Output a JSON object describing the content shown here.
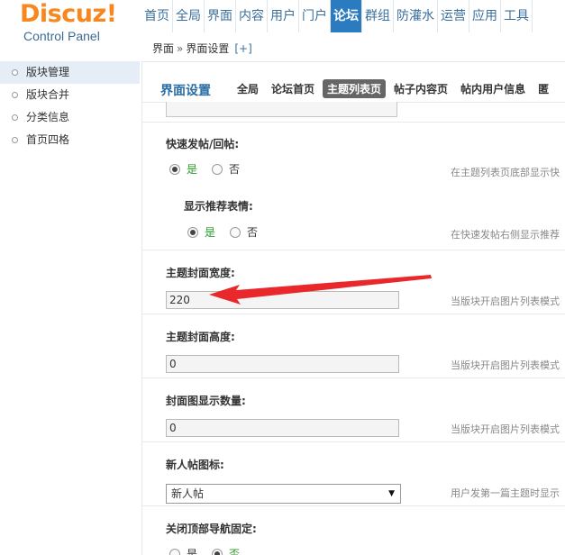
{
  "header": {
    "logo_main": "Discuz",
    "logo_bang": "!",
    "logo_sub": "Control Panel",
    "nav": [
      "首页",
      "全局",
      "界面",
      "内容",
      "用户",
      "门户",
      "论坛",
      "群组",
      "防灌水",
      "运营",
      "应用",
      "工具"
    ],
    "active_nav": "论坛"
  },
  "sidebar": {
    "items": [
      {
        "label": "版块管理"
      },
      {
        "label": "版块合并"
      },
      {
        "label": "分类信息"
      },
      {
        "label": "首页四格"
      }
    ]
  },
  "breadcrumb": {
    "part1": "界面",
    "sep": "»",
    "part2": "界面设置",
    "plus": "[+]"
  },
  "page": {
    "title": "界面设置",
    "tabs": [
      "全局",
      "论坛首页",
      "主题列表页",
      "帖子内容页",
      "帖内用户信息",
      "匿"
    ],
    "active_tab": "主题列表页"
  },
  "form": {
    "fast_post": {
      "label": "快速发帖/回帖:",
      "yes": "是",
      "no": "否",
      "desc": "在主题列表页底部显示快"
    },
    "recommend_emoji": {
      "label": "显示推荐表情:",
      "yes": "是",
      "no": "否",
      "desc": "在快速发帖右侧显示推荐"
    },
    "cover_width": {
      "label": "主题封面宽度:",
      "value": "220",
      "desc": "当版块开启图片列表模式"
    },
    "cover_height": {
      "label": "主题封面高度:",
      "value": "0",
      "desc": "当版块开启图片列表模式"
    },
    "cover_count": {
      "label": "封面图显示数量:",
      "value": "0",
      "desc": "当版块开启图片列表模式"
    },
    "new_post_icon": {
      "label": "新人帖图标:",
      "value": "新人帖",
      "desc": "用户发第一篇主题时显示"
    },
    "fixed_topnav": {
      "label": "关闭顶部导航固定:",
      "yes": "是",
      "no": "否"
    }
  },
  "colors": {
    "logo_orange": "#f6881f",
    "nav_active": "#2b7bc1",
    "annotation_red": "#e8282b"
  }
}
